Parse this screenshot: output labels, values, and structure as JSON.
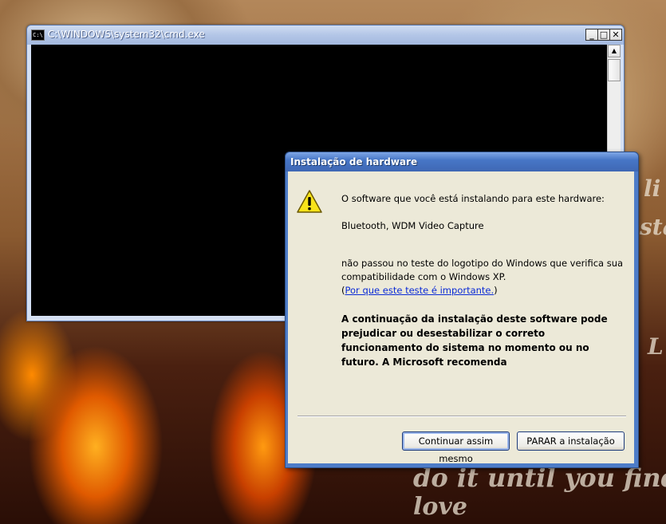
{
  "desktop": {
    "wallpaper_text": [
      "do it until you find",
      "love",
      "li",
      "sta",
      "L"
    ]
  },
  "cmd_window": {
    "title": "C:\\WINDOWS\\system32\\cmd.exe",
    "icon_label": "C:\\",
    "minimize": "_",
    "maximize": "□",
    "close": "✕"
  },
  "dialog": {
    "title": "Instalação de hardware",
    "line1": "O software que você está instalando para este hardware:",
    "device": "Bluetooth, WDM Video Capture",
    "line2": "não passou no teste do logotipo do Windows que verifica sua compatibilidade com o Windows XP.",
    "link_open": "(",
    "link_text": "Por que este teste é importante.",
    "link_close": ")",
    "warning": "A continuação da instalação deste software pode prejudicar ou desestabilizar o correto funcionamento do sistema no momento ou no futuro. A Microsoft recomenda",
    "continue_button": "Continuar assim mesmo",
    "stop_button": "PARAR a instalação"
  },
  "colors": {
    "dialog_title": "#4776c6",
    "dialog_body": "#ece9d8",
    "link": "#0b2bd6",
    "console": "#000000"
  }
}
